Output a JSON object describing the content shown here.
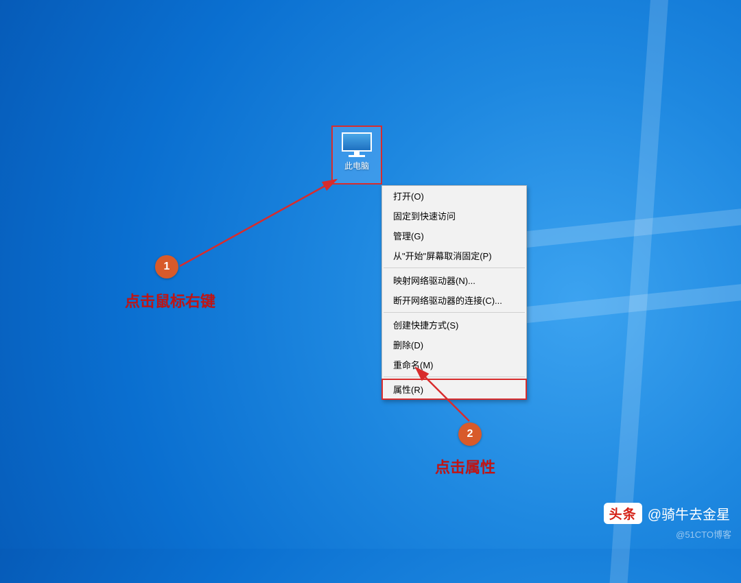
{
  "desktop": {
    "icon_label": "此电脑"
  },
  "context_menu": {
    "group1": [
      "打开(O)",
      "固定到快速访问",
      "管理(G)",
      "从\"开始\"屏幕取消固定(P)"
    ],
    "group2": [
      "映射网络驱动器(N)...",
      "断开网络驱动器的连接(C)..."
    ],
    "group3": [
      "创建快捷方式(S)",
      "删除(D)",
      "重命名(M)"
    ],
    "group4_highlight": "属性(R)"
  },
  "annotations": {
    "step1_num": "1",
    "step1_text": "点击鼠标右键",
    "step2_num": "2",
    "step2_text": "点击属性"
  },
  "watermark": {
    "toutiao_logo": "头条",
    "toutiao_author": "@骑牛去金星",
    "cto": "@51CTO博客"
  },
  "colors": {
    "annotation_red": "#d82c2c",
    "badge_orange": "#d85a2a"
  }
}
